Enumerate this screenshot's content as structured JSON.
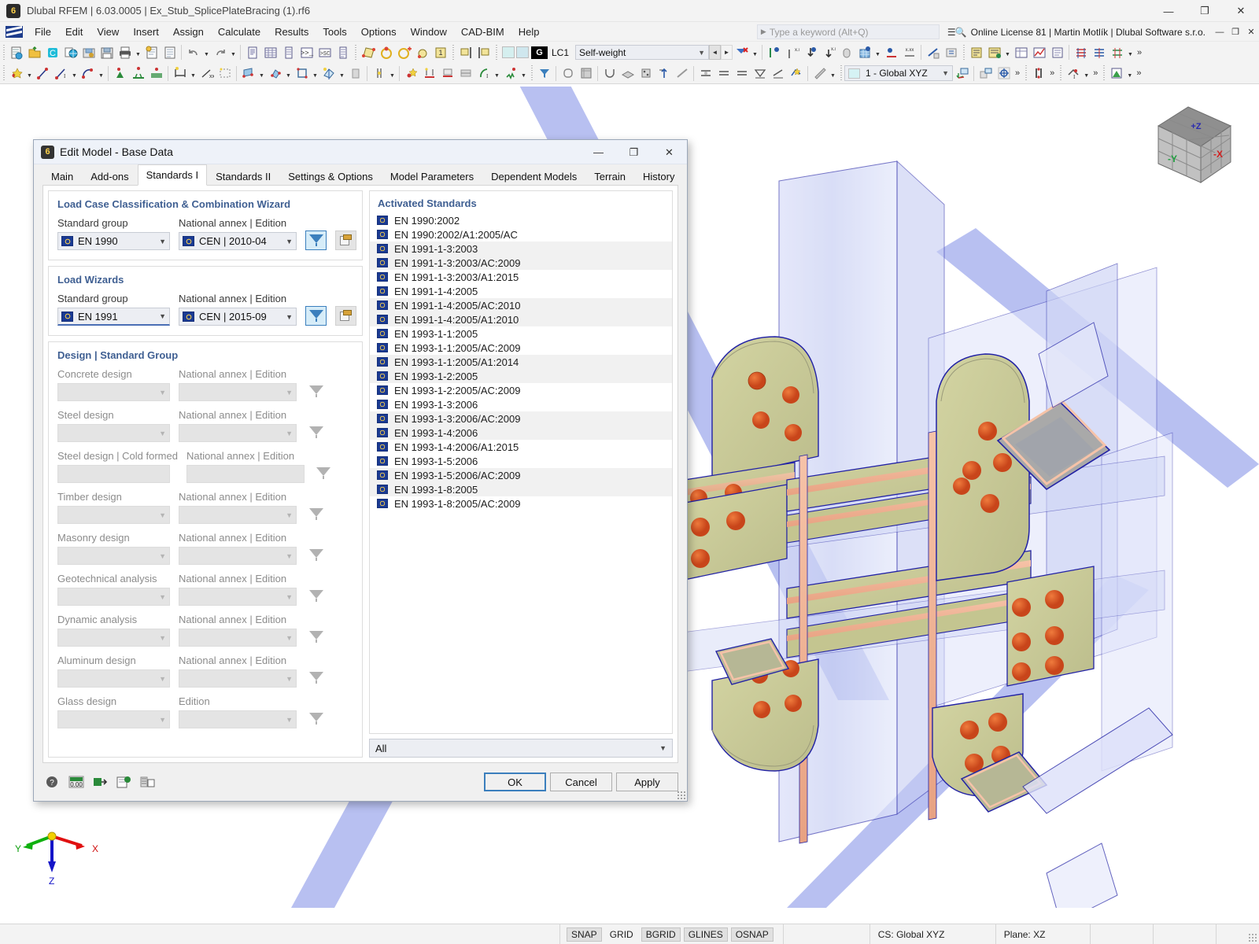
{
  "window": {
    "title": "Dlubal RFEM | 6.03.0005 | Ex_Stub_SplicePlateBracing (1).rf6",
    "minimize": "—",
    "maximize": "❐",
    "close": "✕"
  },
  "menubar": {
    "items": [
      "File",
      "Edit",
      "View",
      "Insert",
      "Assign",
      "Calculate",
      "Results",
      "Tools",
      "Options",
      "Window",
      "CAD-BIM",
      "Help"
    ],
    "keyword_placeholder": "Type a keyword (Alt+Q)",
    "license": "Online License 81 | Martin Motlík | Dlubal Software s.r.o.",
    "minimize": "—",
    "restore": "❐",
    "close": "✕"
  },
  "toolbar": {
    "load_case_tag": "G",
    "load_case_id": "LC1",
    "load_case_name": "Self-weight",
    "coordinate_system": "1 - Global XYZ",
    "prev_arrow": "◄",
    "next_arrow": "►",
    "overflow": "»"
  },
  "dialog": {
    "title": "Edit Model - Base Data",
    "minimize": "—",
    "maximize": "❐",
    "close": "✕",
    "tabs": [
      {
        "label": "Main",
        "active": false
      },
      {
        "label": "Add-ons",
        "active": false
      },
      {
        "label": "Standards I",
        "active": true
      },
      {
        "label": "Standards II",
        "active": false
      },
      {
        "label": "Settings & Options",
        "active": false
      },
      {
        "label": "Model Parameters",
        "active": false
      },
      {
        "label": "Dependent Models",
        "active": false
      },
      {
        "label": "Terrain",
        "active": false
      },
      {
        "label": "History",
        "active": false
      }
    ],
    "load_case_wizard": {
      "title": "Load Case Classification & Combination Wizard",
      "standard_group_label": "Standard group",
      "standard_group_value": "EN 1990",
      "annex_label": "National annex | Edition",
      "annex_value": "CEN | 2010-04"
    },
    "load_wizards": {
      "title": "Load Wizards",
      "standard_group_label": "Standard group",
      "standard_group_value": "EN 1991",
      "annex_label": "National annex | Edition",
      "annex_value": "CEN | 2015-09"
    },
    "design_group": {
      "title": "Design | Standard Group",
      "annex_label": "National annex | Edition",
      "edition_label": "Edition",
      "rows": [
        {
          "label": "Concrete design",
          "value": "",
          "annex_label": "National annex | Edition",
          "annex_value": "",
          "has_chevron": true
        },
        {
          "label": "Steel design",
          "value": "",
          "annex_label": "National annex | Edition",
          "annex_value": "",
          "has_chevron": true
        },
        {
          "label": "Steel design | Cold formed",
          "value": "",
          "annex_label": "National annex | Edition",
          "annex_value": "",
          "has_chevron": false
        },
        {
          "label": "Timber design",
          "value": "",
          "annex_label": "National annex | Edition",
          "annex_value": "",
          "has_chevron": true
        },
        {
          "label": "Masonry design",
          "value": "",
          "annex_label": "National annex | Edition",
          "annex_value": "",
          "has_chevron": true
        },
        {
          "label": "Geotechnical analysis",
          "value": "",
          "annex_label": "National annex | Edition",
          "annex_value": "",
          "has_chevron": true
        },
        {
          "label": "Dynamic analysis",
          "value": "",
          "annex_label": "National annex | Edition",
          "annex_value": "",
          "has_chevron": true
        },
        {
          "label": "Aluminum design",
          "value": "",
          "annex_label": "National annex | Edition",
          "annex_value": "",
          "has_chevron": true
        },
        {
          "label": "Glass design",
          "value": "",
          "annex_label": "Edition",
          "annex_value": "",
          "has_chevron": true
        }
      ]
    },
    "activated_standards": {
      "title": "Activated Standards",
      "items": [
        "EN 1990:2002",
        "EN 1990:2002/A1:2005/AC",
        "EN 1991-1-3:2003",
        "EN 1991-1-3:2003/AC:2009",
        "EN 1991-1-3:2003/A1:2015",
        "EN 1991-1-4:2005",
        "EN 1991-1-4:2005/AC:2010",
        "EN 1991-1-4:2005/A1:2010",
        "EN 1993-1-1:2005",
        "EN 1993-1-1:2005/AC:2009",
        "EN 1993-1-1:2005/A1:2014",
        "EN 1993-1-2:2005",
        "EN 1993-1-2:2005/AC:2009",
        "EN 1993-1-3:2006",
        "EN 1993-1-3:2006/AC:2009",
        "EN 1993-1-4:2006",
        "EN 1993-1-4:2006/A1:2015",
        "EN 1993-1-5:2006",
        "EN 1993-1-5:2006/AC:2009",
        "EN 1993-1-8:2005",
        "EN 1993-1-8:2005/AC:2009"
      ],
      "filter_value": "All"
    },
    "footer": {
      "ok": "OK",
      "cancel": "Cancel",
      "apply": "Apply"
    }
  },
  "viewport": {
    "navcube": {
      "top": "+Z",
      "left": "-Y",
      "right": "-X"
    },
    "axes": {
      "x": "X",
      "y": "Y",
      "z": "Z"
    }
  },
  "statusbar": {
    "toggles": [
      {
        "label": "SNAP",
        "on": true
      },
      {
        "label": "GRID",
        "on": false
      },
      {
        "label": "BGRID",
        "on": true
      },
      {
        "label": "GLINES",
        "on": true
      },
      {
        "label": "OSNAP",
        "on": true
      }
    ],
    "coordinate_system": "CS: Global XYZ",
    "plane": "Plane: XZ"
  },
  "colors": {
    "accent_blue": "#3b7fbd",
    "panel_title": "#3f5f92",
    "plate_fill": "#c9ca96",
    "bolt": "#d9541f",
    "member_blue": "#8c9ae8",
    "edge_blue": "#2020a0"
  }
}
